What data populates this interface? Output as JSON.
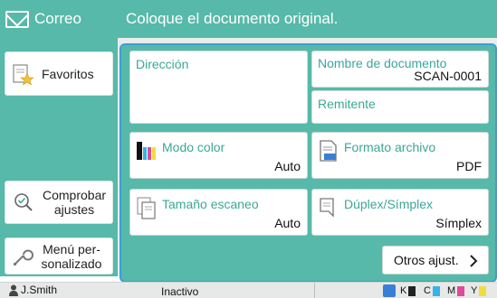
{
  "header": {
    "mode_label": "Correo",
    "message": "Coloque el documento original."
  },
  "sidebar": {
    "favorites_label": "Favoritos",
    "check_settings_label": "Comprobar ajustes",
    "custom_menu_label": "Menú per- sonalizado"
  },
  "fields": {
    "address": {
      "title": "Dirección",
      "value": ""
    },
    "document_name": {
      "title": "Nombre de documento",
      "value": "SCAN-0001"
    },
    "sender": {
      "title": "Remitente",
      "value": ""
    }
  },
  "options": {
    "color_mode": {
      "title": "Modo color",
      "value": "Auto"
    },
    "file_format": {
      "title": "Formato archivo",
      "value": "PDF"
    },
    "scan_size": {
      "title": "Tamaño escaneo",
      "value": "Auto"
    },
    "duplex": {
      "title": "Dúplex/Símplex",
      "value": "Símplex"
    },
    "other_label": "Otros ajust."
  },
  "status_bar": {
    "user": "J.Smith",
    "state": "Inactivo",
    "inks": [
      {
        "label": "K",
        "color": "#222222"
      },
      {
        "label": "C",
        "color": "#35b4e6"
      },
      {
        "label": "M",
        "color": "#e04a9b"
      },
      {
        "label": "Y",
        "color": "#f2dc3c"
      }
    ]
  },
  "colors": {
    "accent": "#57b9a9",
    "title_text": "#3aa897",
    "focus_border": "#3a9fd6"
  }
}
